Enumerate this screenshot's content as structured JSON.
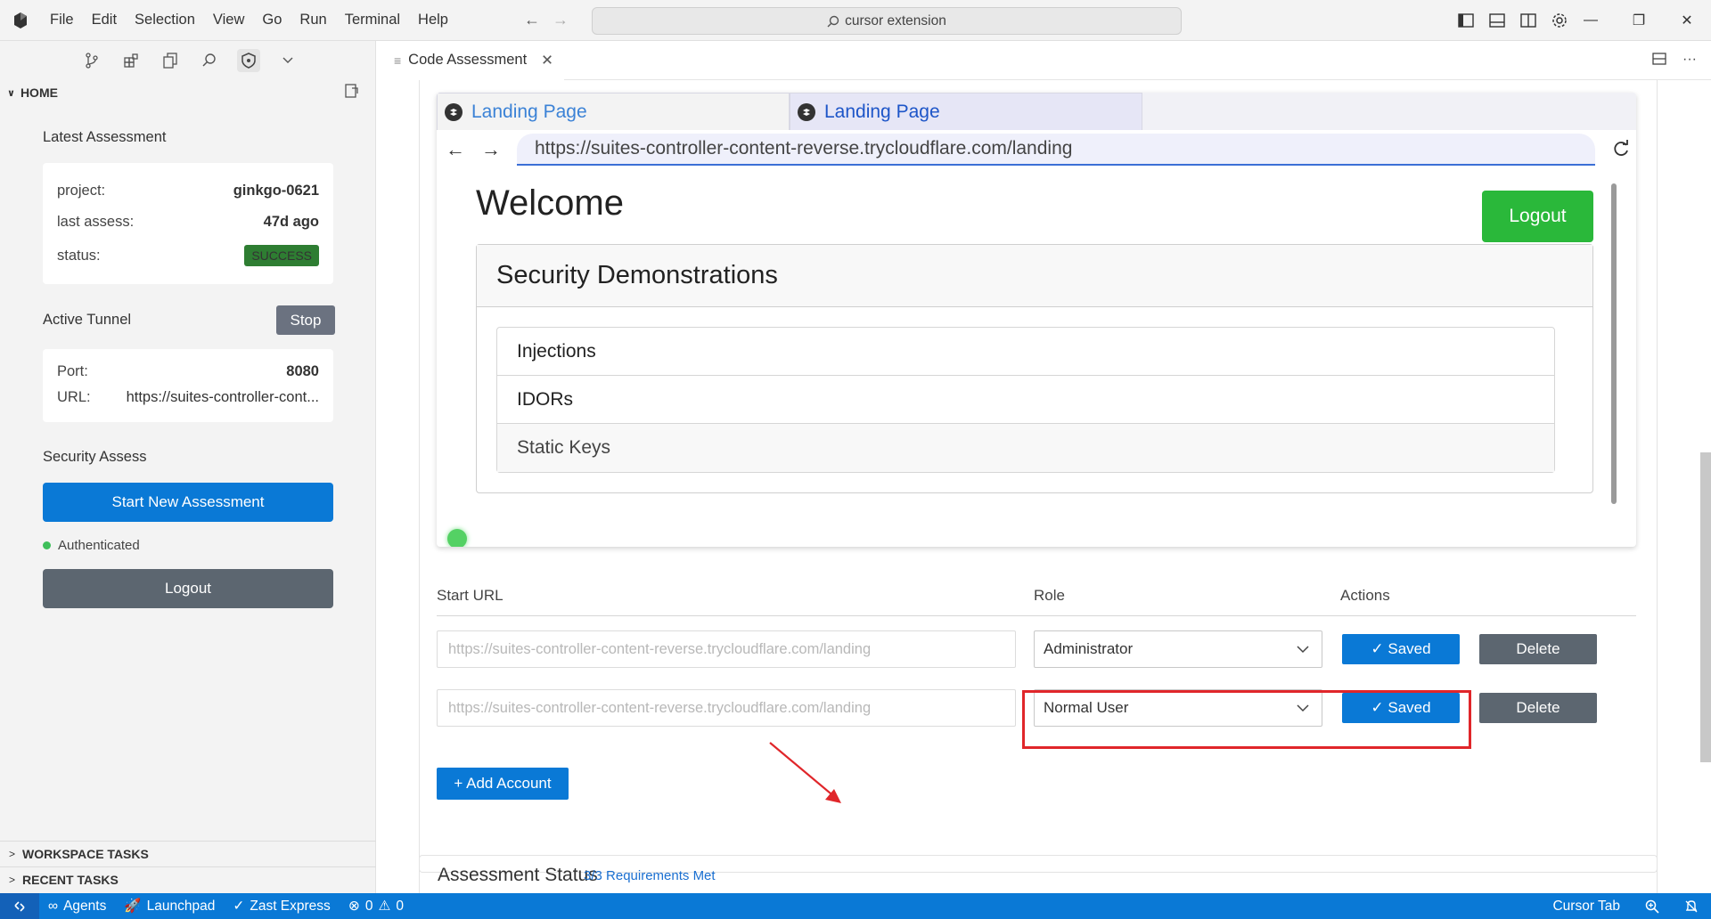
{
  "menu": [
    "File",
    "Edit",
    "Selection",
    "View",
    "Go",
    "Run",
    "Terminal",
    "Help"
  ],
  "command_center": "cursor extension",
  "sidebar": {
    "section_title": "HOME",
    "latest_assessment": {
      "title": "Latest Assessment",
      "project_label": "project:",
      "project_value": "ginkgo-0621",
      "last_assess_label": "last assess:",
      "last_assess_value": "47d ago",
      "status_label": "status:",
      "status_value": "SUCCESS"
    },
    "active_tunnel": {
      "title": "Active Tunnel",
      "stop_label": "Stop",
      "port_label": "Port:",
      "port_value": "8080",
      "url_label": "URL:",
      "url_value": "https://suites-controller-cont..."
    },
    "security_assess": {
      "title": "Security Assess",
      "start_label": "Start New Assessment",
      "auth_text": "Authenticated",
      "logout_label": "Logout"
    },
    "workspace_tasks": "WORKSPACE TASKS",
    "recent_tasks": "RECENT TASKS"
  },
  "editor": {
    "tab_label": "Code Assessment",
    "browser": {
      "tabs": [
        "Landing Page",
        "Landing Page"
      ],
      "url": "https://suites-controller-content-reverse.trycloudflare.com/landing",
      "welcome": "Welcome",
      "logout_label": "Logout",
      "demo_title": "Security Demonstrations",
      "demo_items": [
        "Injections",
        "IDORs",
        "Static Keys"
      ]
    },
    "accounts": {
      "headers": {
        "start_url": "Start URL",
        "role": "Role",
        "actions": "Actions"
      },
      "rows": [
        {
          "url_placeholder": "https://suites-controller-content-reverse.trycloudflare.com/landing",
          "role": "Administrator",
          "saved_label": "✓ Saved",
          "delete_label": "Delete"
        },
        {
          "url_placeholder": "https://suites-controller-content-reverse.trycloudflare.com/landing",
          "role": "Normal User",
          "saved_label": "✓ Saved",
          "delete_label": "Delete"
        }
      ],
      "add_label": "+ Add Account"
    },
    "assessment_status": {
      "title": "Assessment Status",
      "requirements": "3/3 Requirements Met"
    }
  },
  "statusbar": {
    "agents": "Agents",
    "launchpad": "Launchpad",
    "zast": "Zast Express",
    "errors": "0",
    "warnings": "0",
    "cursor_tab": "Cursor Tab"
  },
  "colors": {
    "accent": "#0a79d6",
    "success": "#2e7d32",
    "logout_green": "#2ab83a",
    "highlight": "#e0262a"
  }
}
